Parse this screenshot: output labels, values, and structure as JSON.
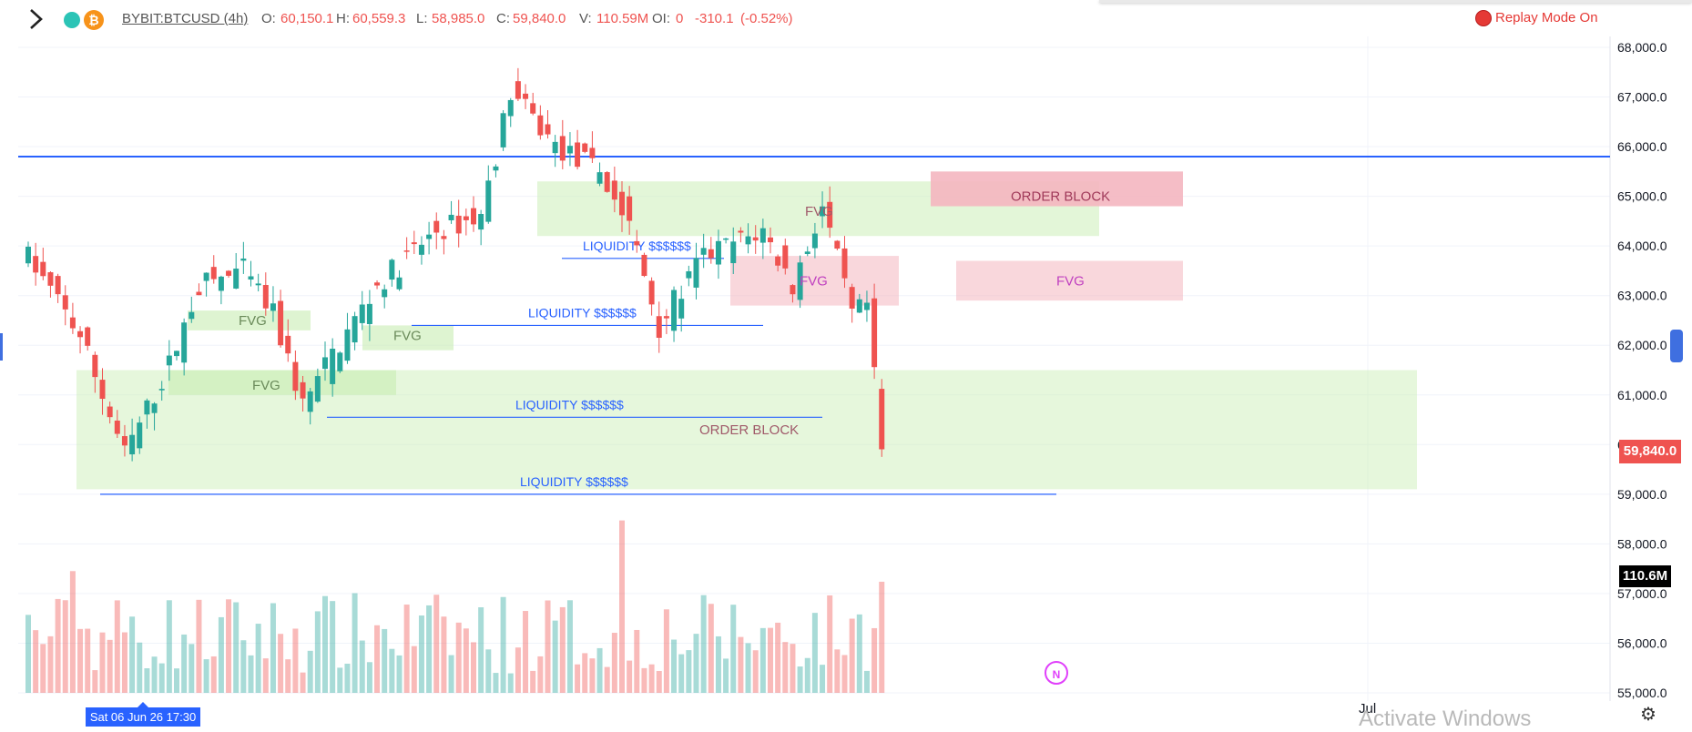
{
  "header": {
    "symbol": "BYBIT:BTCUSD (4h)",
    "o_label": "O:",
    "o_value": "60,150.1",
    "h_label": "H:",
    "h_value": "60,559.3",
    "l_label": "L:",
    "l_value": "58,985.0",
    "c_label": "C:",
    "c_value": "59,840.0",
    "v_label": "V:",
    "v_value": "110.59M",
    "oi_label": "OI:",
    "oi_value": "0",
    "change": "-310.1",
    "change_pct": "(-0.52%)",
    "coin_glyph": "₿",
    "replay": "Replay Mode On"
  },
  "price_axis": {
    "ticks": [
      "68,000.0",
      "67,000.0",
      "66,000.0",
      "65,000.0",
      "64,000.0",
      "63,000.0",
      "62,000.0",
      "61,000.0",
      "60,000.0",
      "59,000.0",
      "58,000.0",
      "57,000.0",
      "56,000.0",
      "55,000.0"
    ],
    "current_price": "59,840.0",
    "volume_tag": "110.6M"
  },
  "time_axis": {
    "cursor_date": "Sat 06 Jun 26  17:30",
    "month_label": "Jul",
    "watermark": "Activate Windows"
  },
  "annotations": {
    "fvg": "FVG",
    "order_block": "ORDER BLOCK",
    "liquidity": "LIQUIDITY $$$$$$",
    "news_badge": "N"
  },
  "icons": [
    "chevron-right-icon",
    "settings-icon"
  ],
  "colors": {
    "bull": "#26a69a",
    "bear": "#ef5350",
    "level_line": "#2962ff",
    "zone_green": "#c8edb2",
    "zone_red": "#f4b6c0",
    "replay": "#e53935"
  },
  "chart_data": {
    "type": "candlestick",
    "title": "",
    "y_axis": {
      "range": [
        55000,
        68000
      ],
      "unit": "USD"
    },
    "horizontal_level": 65800,
    "bars_visible": 116,
    "last_candle": {
      "open": 60150.1,
      "high": 60559.3,
      "low": 58985.0,
      "close": 59840.0,
      "volume": "110.59M"
    },
    "zones": [
      {
        "label": "ORDER BLOCK",
        "color": "red",
        "price_range": [
          64800,
          65500
        ]
      },
      {
        "label": "FVG",
        "color": "green",
        "price_range": [
          64200,
          65300
        ]
      },
      {
        "label": "FVG",
        "color": "red",
        "price_range": [
          62800,
          63800
        ]
      },
      {
        "label": "FVG",
        "color": "red",
        "price_range": [
          62900,
          63700
        ]
      },
      {
        "label": "FVG",
        "color": "green",
        "price_range": [
          62300,
          62700
        ]
      },
      {
        "label": "FVG",
        "color": "green",
        "price_range": [
          61900,
          62400
        ]
      },
      {
        "label": "FVG",
        "color": "green",
        "price_range": [
          61000,
          61500
        ]
      },
      {
        "label": "ORDER BLOCK",
        "color": "green",
        "price_range": [
          59100,
          61500
        ]
      }
    ],
    "liquidity_lines": [
      63750,
      62400,
      60550,
      59000
    ]
  }
}
